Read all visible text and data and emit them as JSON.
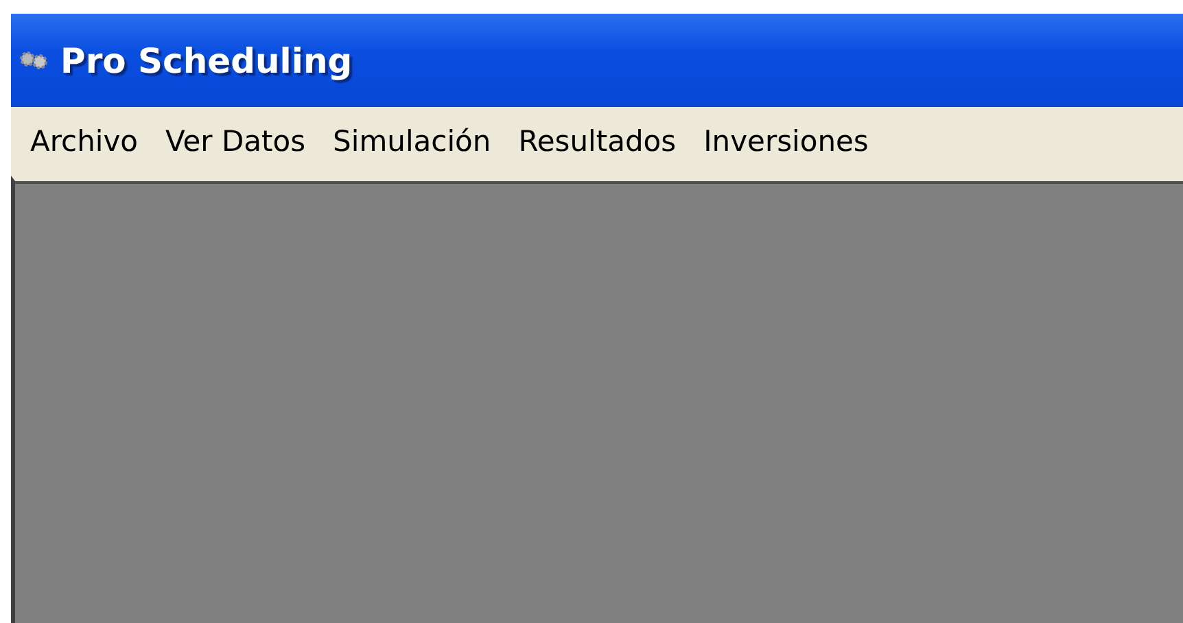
{
  "window": {
    "title": "Pro Scheduling"
  },
  "menu": [
    {
      "label": "Archivo"
    },
    {
      "label": "Ver Datos"
    },
    {
      "label": "Simulación"
    },
    {
      "label": "Resultados"
    },
    {
      "label": "Inversiones"
    }
  ]
}
